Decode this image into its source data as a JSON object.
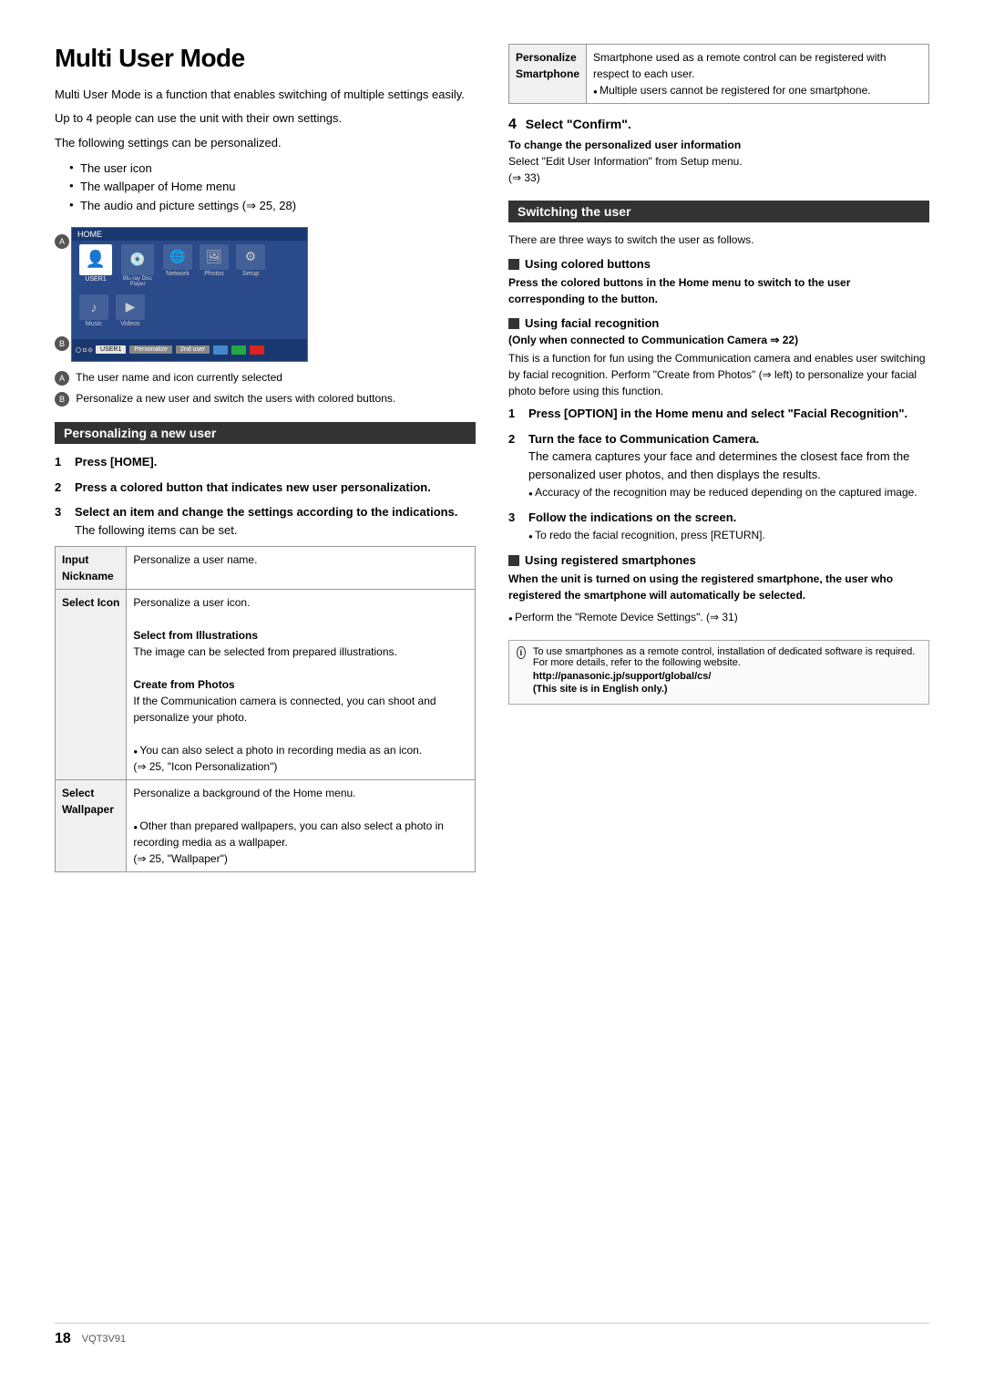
{
  "page": {
    "title": "Multi User Mode",
    "intro": [
      "Multi User Mode is a function that enables switching of multiple settings easily.",
      "Up to 4 people can use the unit with their own settings.",
      "",
      "The following settings can be personalized."
    ],
    "bullets": [
      "The user icon",
      "The wallpaper of Home menu",
      "The audio and picture settings (⇒ 25, 28)"
    ],
    "caption_a": "The user name and icon currently selected",
    "caption_b": "Personalize a new user and switch the users with colored buttons.",
    "left_section": {
      "title": "Personalizing a new user",
      "step1": "Press [HOME].",
      "step2_bold": "Press a colored button that indicates new user personalization.",
      "step3_bold": "Select an item and change the settings according to the indications.",
      "step3_sub": "The following items can be set.",
      "table": {
        "rows": [
          {
            "header": "Input\nNickname",
            "content": "Personalize a user name."
          },
          {
            "header": "Select Icon",
            "content_parts": [
              "Personalize a user icon.",
              "Select from Illustrations",
              "The image can be selected from prepared illustrations.",
              "Create from Photos",
              "If the Communication camera is connected, you can shoot and personalize your photo.",
              "● You can also select a photo in recording media as an icon.\n(⇒ 25, \"Icon Personalization\")"
            ]
          },
          {
            "header": "Select\nWallpaper",
            "content_parts": [
              "Personalize a background of the Home menu.",
              "● Other than prepared wallpapers, you can also select a photo in recording media as a wallpaper.\n(⇒ 25, \"Wallpaper\")"
            ]
          }
        ]
      }
    },
    "right_section": {
      "personalize_table": {
        "header": "Personalize\nSmartphone",
        "content": "Smartphone used as a remote control can be registered with respect to each user.\n● Multiple users cannot be registered for one smartphone."
      },
      "step4": "Select \"Confirm\".",
      "change_info_bold": "To change the personalized user information",
      "change_info": "Select \"Edit User Information\" from Setup menu.\n(⇒ 33)",
      "switch_section": {
        "title": "Switching the user",
        "intro": "There are three ways to switch the user as follows.",
        "subsections": [
          {
            "title": "Using colored buttons",
            "bold_text": "Press the colored buttons in the Home menu to switch to the user corresponding to the button."
          },
          {
            "title": "Using facial recognition",
            "note": "(Only when connected to Communication Camera ⇒ 22)",
            "body": "This is a function for fun using the Communication camera and enables user switching by facial recognition. Perform \"Create from Photos\" (⇒ left) to personalize your facial photo before using this function.",
            "steps": [
              {
                "num": "1",
                "bold": "Press [OPTION] in the Home menu and select \"Facial Recognition\"."
              },
              {
                "num": "2",
                "bold": "Turn the face to Communication Camera.",
                "body": "The camera captures your face and determines the closest face from the personalized user photos, and then displays the results.",
                "bullet": "Accuracy of the recognition may be reduced depending on the captured image."
              },
              {
                "num": "3",
                "bold": "Follow the indications on the screen.",
                "bullet": "To redo the facial recognition, press [RETURN]."
              }
            ]
          },
          {
            "title": "Using registered smartphones",
            "bold_text": "When the unit is turned on using the registered smartphone, the user who registered the smartphone will automatically be selected.",
            "bullet": "Perform the \"Remote Device Settings\". (⇒ 31)"
          }
        ]
      },
      "notes": [
        "To use smartphones as a remote control, installation of dedicated software is required. For more details, refer to the following website.",
        "http://panasonic.jp/support/global/cs/",
        "(This site is in English only.)"
      ]
    },
    "footer": {
      "page_num": "18",
      "page_code": "VQT3V91"
    }
  }
}
